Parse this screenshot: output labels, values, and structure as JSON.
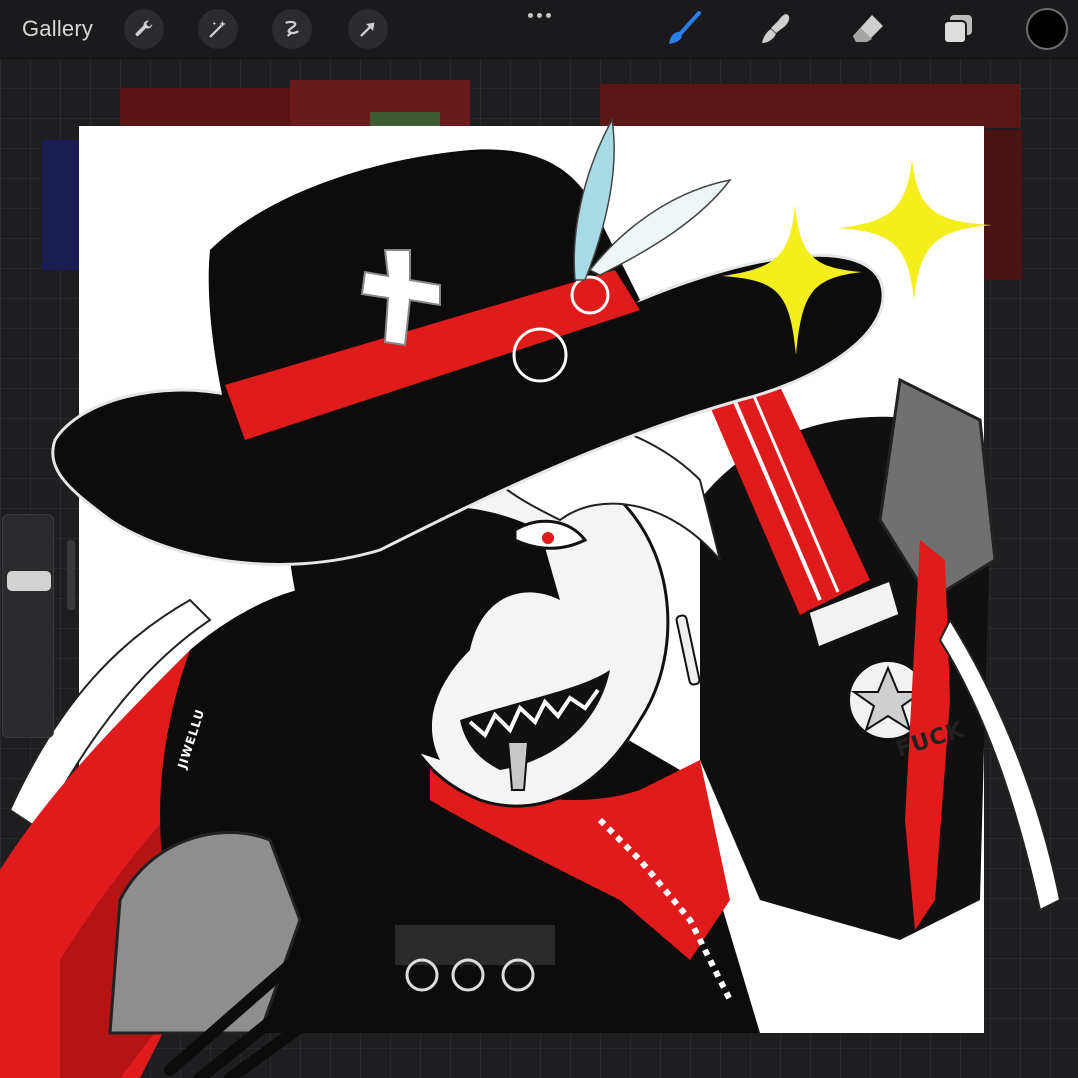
{
  "toolbar": {
    "gallery_label": "Gallery",
    "left_tools": [
      {
        "name": "wrench-icon",
        "label": "Actions"
      },
      {
        "name": "magic-wand-icon",
        "label": "Adjustments"
      },
      {
        "name": "selection-icon",
        "label": "Selection"
      },
      {
        "name": "transform-arrow-icon",
        "label": "Transform"
      }
    ],
    "more_icon": "more-dots-icon",
    "right_tools": [
      {
        "name": "brush-icon",
        "active": true,
        "color": "#2b7de9"
      },
      {
        "name": "smudge-icon",
        "active": false
      },
      {
        "name": "eraser-icon",
        "active": false
      },
      {
        "name": "layers-icon",
        "active": false
      }
    ],
    "current_color": "#000000"
  },
  "sidebar": {
    "brush_size_icon": "size-slider",
    "opacity_icon": "opacity-slider",
    "modify_button_icon": "modify-square"
  },
  "canvas": {
    "watermark": "JIWELLU",
    "patch_text": "FUCK",
    "palette": {
      "red": "#e01b1b",
      "black": "#0c0c0c",
      "white": "#ffffff",
      "yellow": "#f4ee1c",
      "gray": "#9a9a9a",
      "feather_blue": "#a9dbe6"
    }
  }
}
